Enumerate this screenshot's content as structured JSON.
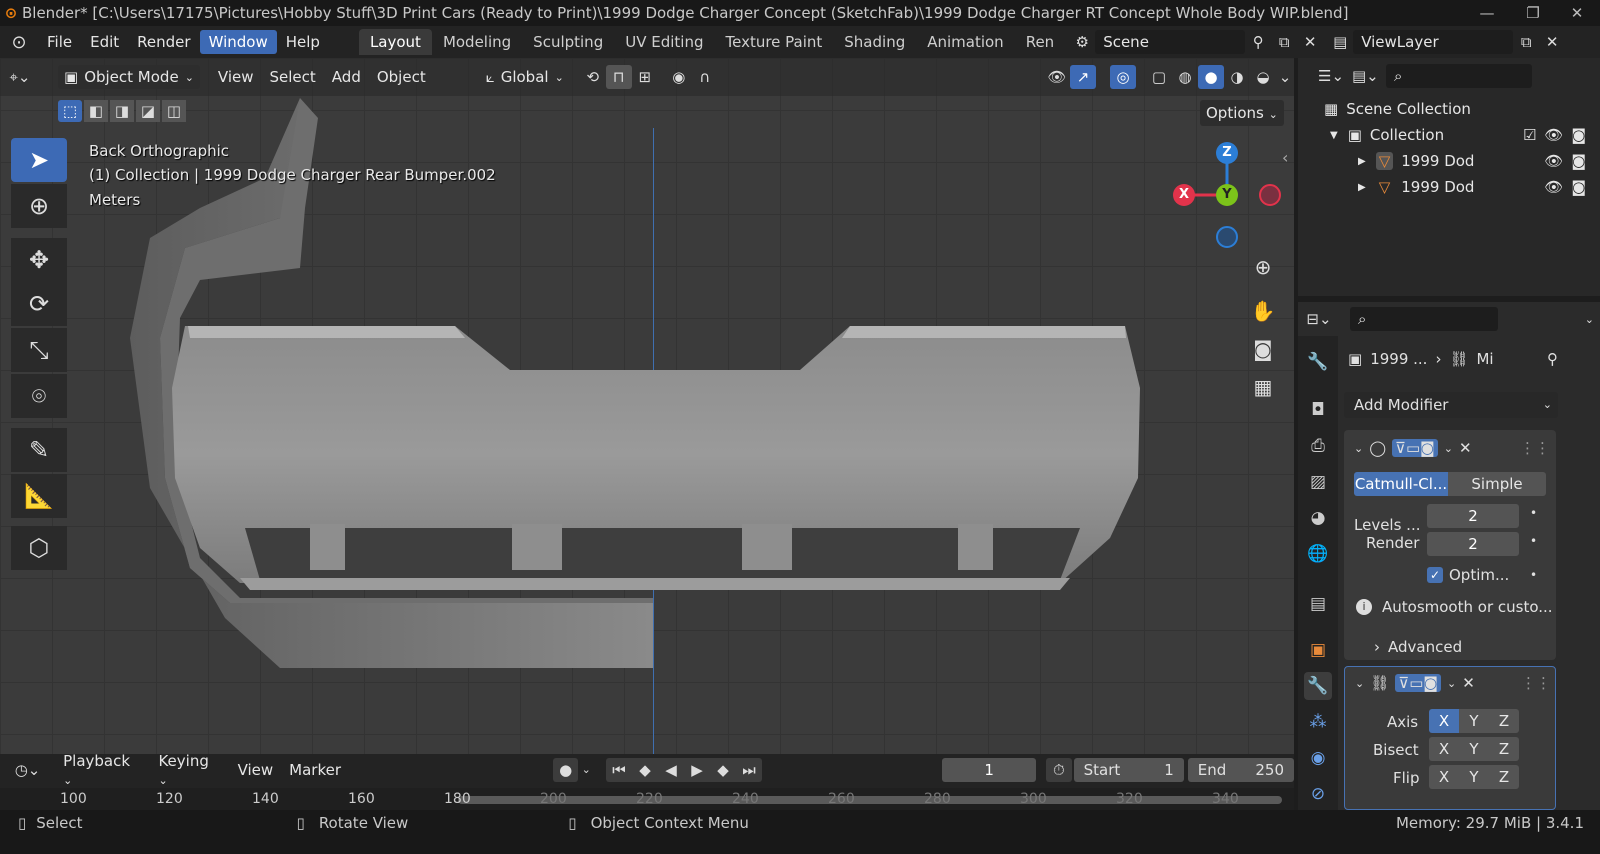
{
  "window": {
    "title": "Blender* [C:\\Users\\17175\\Pictures\\Hobby Stuff\\3D Print Cars (Ready to Print)\\1999 Dodge Charger Concept (SketchFab)\\1999 Dodge Charger RT Concept Whole Body WIP.blend]",
    "controls": [
      "—",
      "❐",
      "✕"
    ]
  },
  "menu": [
    "File",
    "Edit",
    "Render",
    "Window",
    "Help"
  ],
  "menu_active": "Window",
  "workspaces": [
    "Layout",
    "Modeling",
    "Sculpting",
    "UV Editing",
    "Texture Paint",
    "Shading",
    "Animation",
    "Ren"
  ],
  "workspace_active": "Layout",
  "scene": {
    "label": "Scene"
  },
  "view_layer": {
    "label": "ViewLayer"
  },
  "viewport_header": {
    "mode": "Object Mode",
    "items": [
      "View",
      "Select",
      "Add",
      "Object"
    ],
    "transform_orientation": "Global",
    "options_label": "Options"
  },
  "viewport_info": {
    "line1": "Back Orthographic",
    "line2": "(1) Collection | 1999 Dodge Charger Rear Bumper.002",
    "line3": "Meters"
  },
  "gizmo": {
    "z": "Z",
    "y": "Y",
    "x": "X"
  },
  "outliner": {
    "scene_collection": "Scene Collection",
    "collection": "Collection",
    "items": [
      "1999 Dod",
      "1999 Dod"
    ]
  },
  "properties": {
    "breadcrumb_object": "1999 ...",
    "breadcrumb_modifier": "Mi",
    "add_modifier": "Add Modifier",
    "subdiv": {
      "mode_a": "Catmull-Cl...",
      "mode_b": "Simple",
      "levels_label": "Levels ...",
      "levels_value": "2",
      "render_label": "Render",
      "render_value": "2",
      "optimal_label": "Optim...",
      "info": "Autosmooth or custo...",
      "advanced": "Advanced"
    },
    "mirror": {
      "axis_label": "Axis",
      "bisect_label": "Bisect",
      "flip_label": "Flip",
      "x": "X",
      "y": "Y",
      "z": "Z"
    }
  },
  "timeline": {
    "menu": [
      "Playback",
      "Keying",
      "View",
      "Marker"
    ],
    "current_frame": "1",
    "start_label": "Start",
    "start_value": "1",
    "end_label": "End",
    "end_value": "250",
    "ruler": [
      "100",
      "120",
      "140",
      "160",
      "180",
      "200",
      "220",
      "240",
      "260",
      "280",
      "300",
      "320",
      "340"
    ]
  },
  "status": {
    "select": "Select",
    "rotate": "Rotate View",
    "context": "Object Context Menu",
    "memory": "Memory: 29.7 MiB | 3.4.1"
  },
  "colors": {
    "accent": "#4772b3",
    "gizmo_x": "#e2334b",
    "gizmo_y": "#7cc31a",
    "gizmo_z": "#2c7ed6"
  }
}
